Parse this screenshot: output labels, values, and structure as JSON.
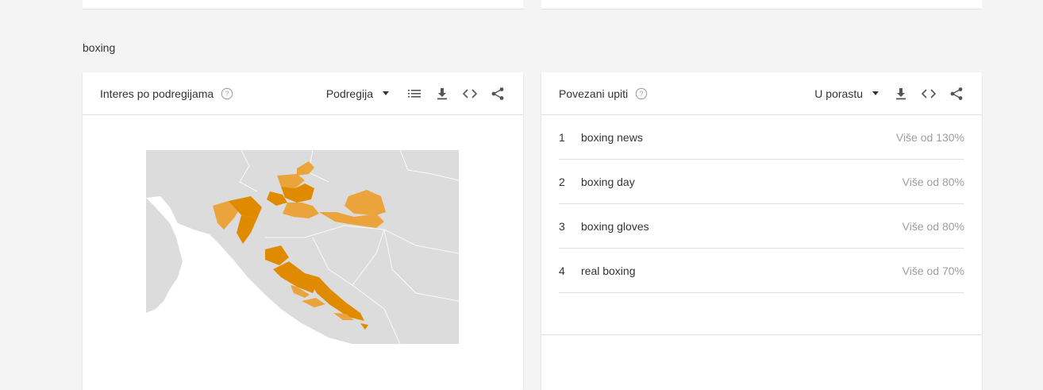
{
  "section": {
    "title": "boxing"
  },
  "left_card": {
    "title": "Interes po podregijama",
    "dropdown_label": "Podregija",
    "colors": {
      "region_dark": "#e08a00",
      "region_light": "#eba43c",
      "land": "#dcdcdc",
      "sea": "#ffffff"
    }
  },
  "right_card": {
    "title": "Povezani upiti",
    "dropdown_label": "U porastu",
    "rows": [
      {
        "rank": "1",
        "query": "boxing news",
        "value": "Više od 130%"
      },
      {
        "rank": "2",
        "query": "boxing day",
        "value": "Više od 80%"
      },
      {
        "rank": "3",
        "query": "boxing gloves",
        "value": "Više od 80%"
      },
      {
        "rank": "4",
        "query": "real boxing",
        "value": "Više od 70%"
      }
    ]
  }
}
